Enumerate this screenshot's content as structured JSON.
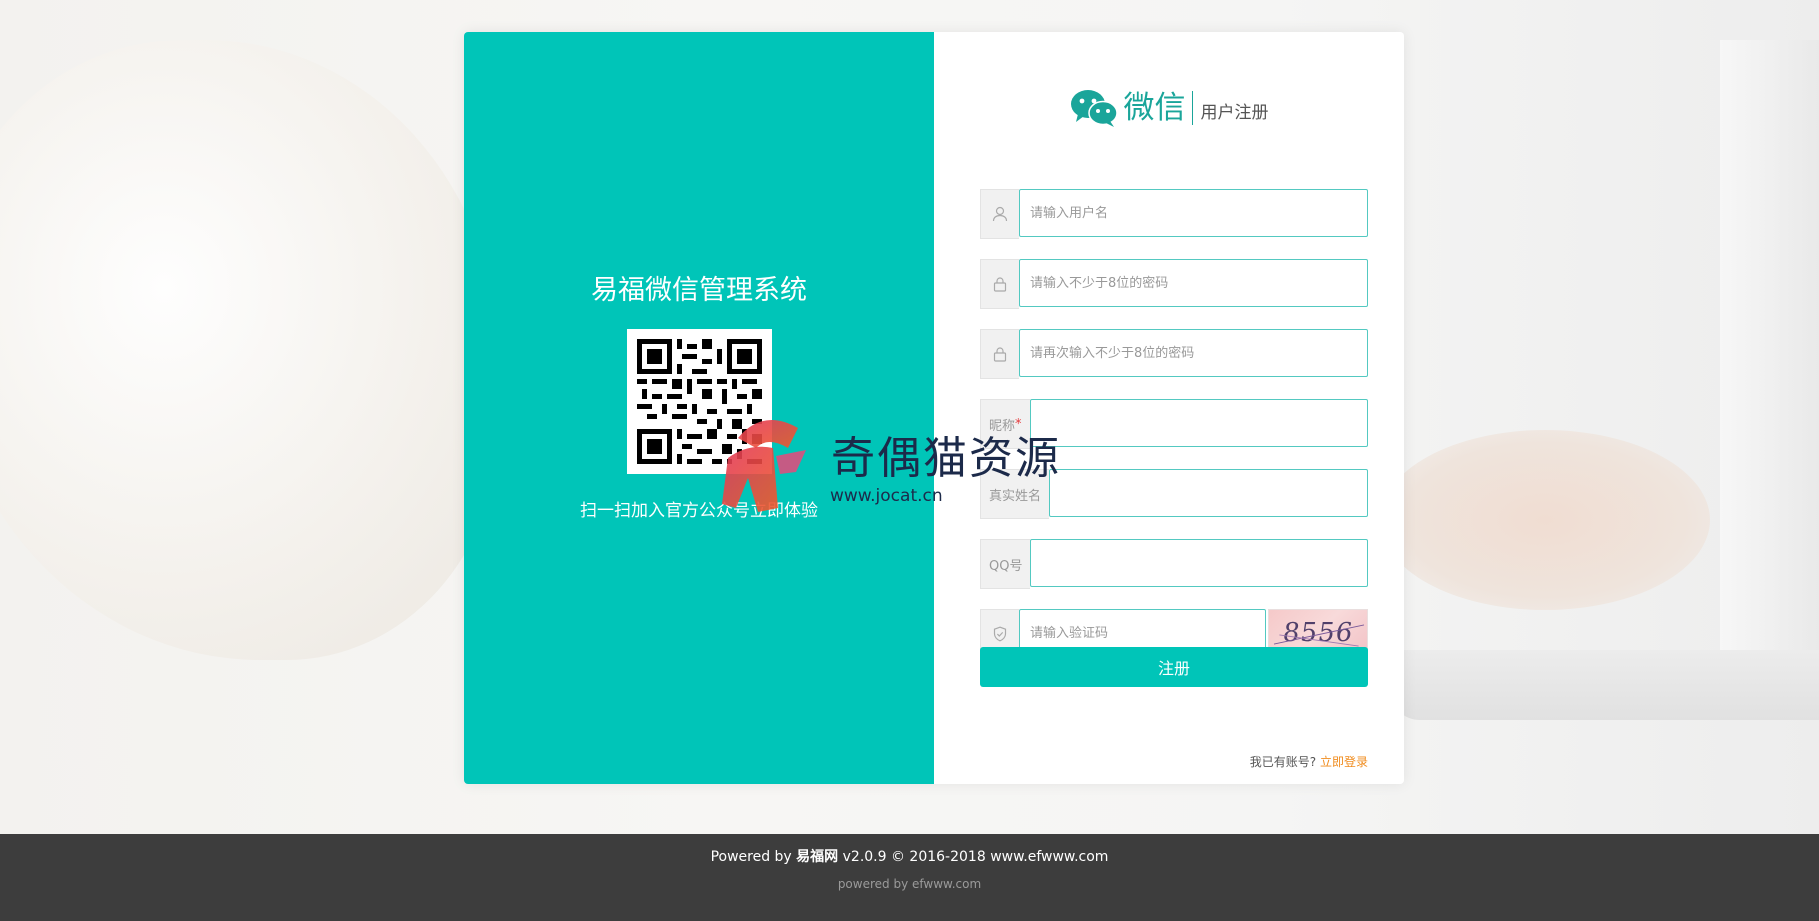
{
  "left_panel": {
    "title": "易福微信管理系统",
    "scan_text": "扫一扫加入官方公众号立即体验"
  },
  "header": {
    "brand_text": "微信",
    "subtitle": "用户注册"
  },
  "form": {
    "username_placeholder": "请输入用户名",
    "password_placeholder": "请输入不少于8位的密码",
    "confirm_placeholder": "请再次输入不少于8位的密码",
    "nickname_label": "昵称",
    "nickname_required": "*",
    "realname_label": "真实姓名",
    "qq_label": "QQ号",
    "captcha_placeholder": "请输入验证码",
    "captcha_code": "8556",
    "register_label": "注册",
    "have_account_text": "我已有账号?",
    "login_link": "立即登录"
  },
  "watermark": {
    "title": "奇偶猫资源",
    "url": "www.jocat.cn"
  },
  "footer": {
    "powered_prefix": "Powered by ",
    "powered_brand": "易福网",
    "powered_suffix": " v2.0.9 © 2016-2018 www.efwww.com",
    "sub": "powered by efwww.com"
  },
  "colors": {
    "accent": "#00c5b8",
    "link": "#f08c1e",
    "footer_bg": "#3d3d3d"
  },
  "icons": [
    "user-icon",
    "lock-icon",
    "shield-icon",
    "wechat-icon"
  ]
}
